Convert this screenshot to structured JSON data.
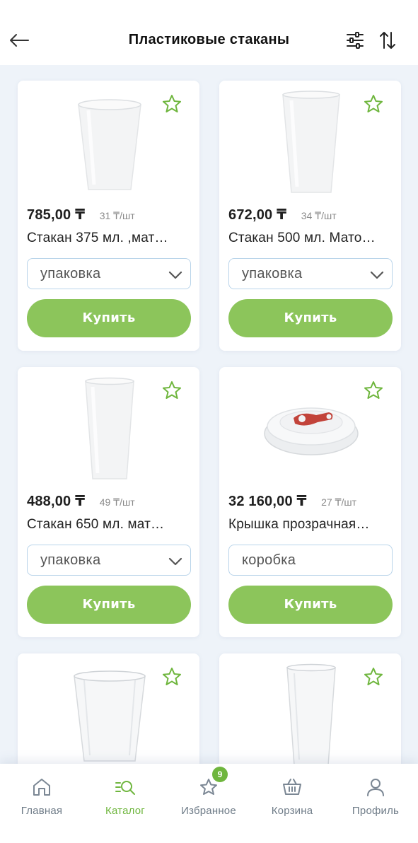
{
  "header": {
    "title": "Пластиковые стаканы",
    "back_icon": "arrow-left-icon",
    "filter_icon": "sliders-icon",
    "sort_icon": "sort-arrows-icon"
  },
  "products": [
    {
      "price": "785,00 ₸",
      "unit_price": "31 ₸/шт",
      "name": "Стакан 375 мл. ,мат…",
      "pack": "упаковка",
      "buy": "Купить",
      "image": "plastic-cup"
    },
    {
      "price": "672,00 ₸",
      "unit_price": "34 ₸/шт",
      "name": "Стакан 500 мл. Мато…",
      "pack": "упаковка",
      "buy": "Купить",
      "image": "plastic-cup"
    },
    {
      "price": "488,00 ₸",
      "unit_price": "49 ₸/шт",
      "name": "Стакан  650 мл. мат…",
      "pack": "упаковка",
      "buy": "Купить",
      "image": "plastic-cup-tall"
    },
    {
      "price": "32 160,00 ₸",
      "unit_price": "27 ₸/шт",
      "name": "Крышка прозрачная…",
      "pack": "коробка",
      "buy": "Купить",
      "image": "cup-lid-red-valve"
    },
    {
      "image": "clear-cup"
    },
    {
      "image": "clear-cup-tall"
    }
  ],
  "nav": [
    {
      "label": "Главная",
      "icon": "home-icon"
    },
    {
      "label": "Каталог",
      "icon": "catalog-search-icon",
      "active": true
    },
    {
      "label": "Избранное",
      "icon": "star-icon",
      "badge": "9"
    },
    {
      "label": "Корзина",
      "icon": "basket-icon"
    },
    {
      "label": "Профиль",
      "icon": "profile-icon"
    }
  ],
  "colors": {
    "accent": "#8cc55b",
    "accent_dark": "#6fb63e",
    "background": "#eef3f9",
    "select_border": "#b9d4ea",
    "lid_red": "#c2433a"
  }
}
